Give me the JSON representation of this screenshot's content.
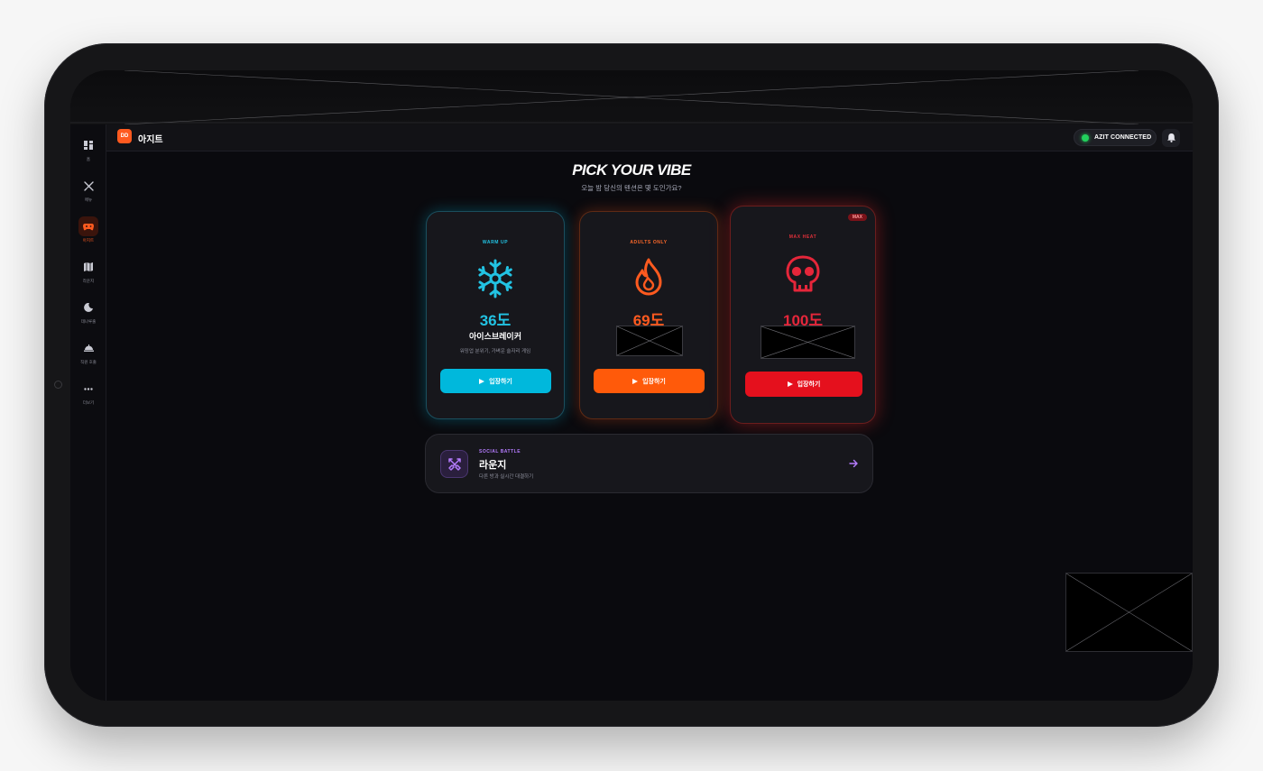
{
  "app": {
    "logo_text": "DD",
    "name": "아지트"
  },
  "sidebar": {
    "items": [
      {
        "label": "홈",
        "icon": "dashboard-icon",
        "active": false
      },
      {
        "label": "메뉴",
        "icon": "utensils-icon",
        "active": false
      },
      {
        "label": "아지트",
        "icon": "gamepad-icon",
        "active": true
      },
      {
        "label": "라운지",
        "icon": "map-icon",
        "active": false
      },
      {
        "label": "데나루출",
        "icon": "moon-icon",
        "active": false
      },
      {
        "label": "직원 호출",
        "icon": "service-bell-icon",
        "active": false
      },
      {
        "label": "더보기",
        "icon": "more-dots-icon",
        "active": false
      }
    ]
  },
  "header": {
    "status": "AZIT CONNECTED",
    "status_color": "#22d05c"
  },
  "main": {
    "title": "PICK YOUR VIBE",
    "subtitle": "오늘 밤 당신의 텐션은 몇 도인가요?",
    "cards": [
      {
        "tag": "WARM UP",
        "temp": "36도",
        "name": "아이스브레이커",
        "desc": "워밍업 분위기, 가벼운 술자리 게임",
        "button": "입장하기",
        "accent": "#22c3e3",
        "icon": "snowflake-icon"
      },
      {
        "tag": "ADULTS ONLY",
        "temp": "69도",
        "button": "입장하기",
        "accent": "#ff5a1f",
        "icon": "flame-icon"
      },
      {
        "tag": "MAX HEAT",
        "temp": "100도",
        "badge": "MAX",
        "button": "입장하기",
        "accent": "#e5101d",
        "icon": "skull-icon"
      }
    ],
    "lounge": {
      "tag": "SOCIAL BATTLE",
      "title": "라운지",
      "desc": "다른 방과 실시간 대결하기",
      "icon": "swords-icon"
    }
  }
}
